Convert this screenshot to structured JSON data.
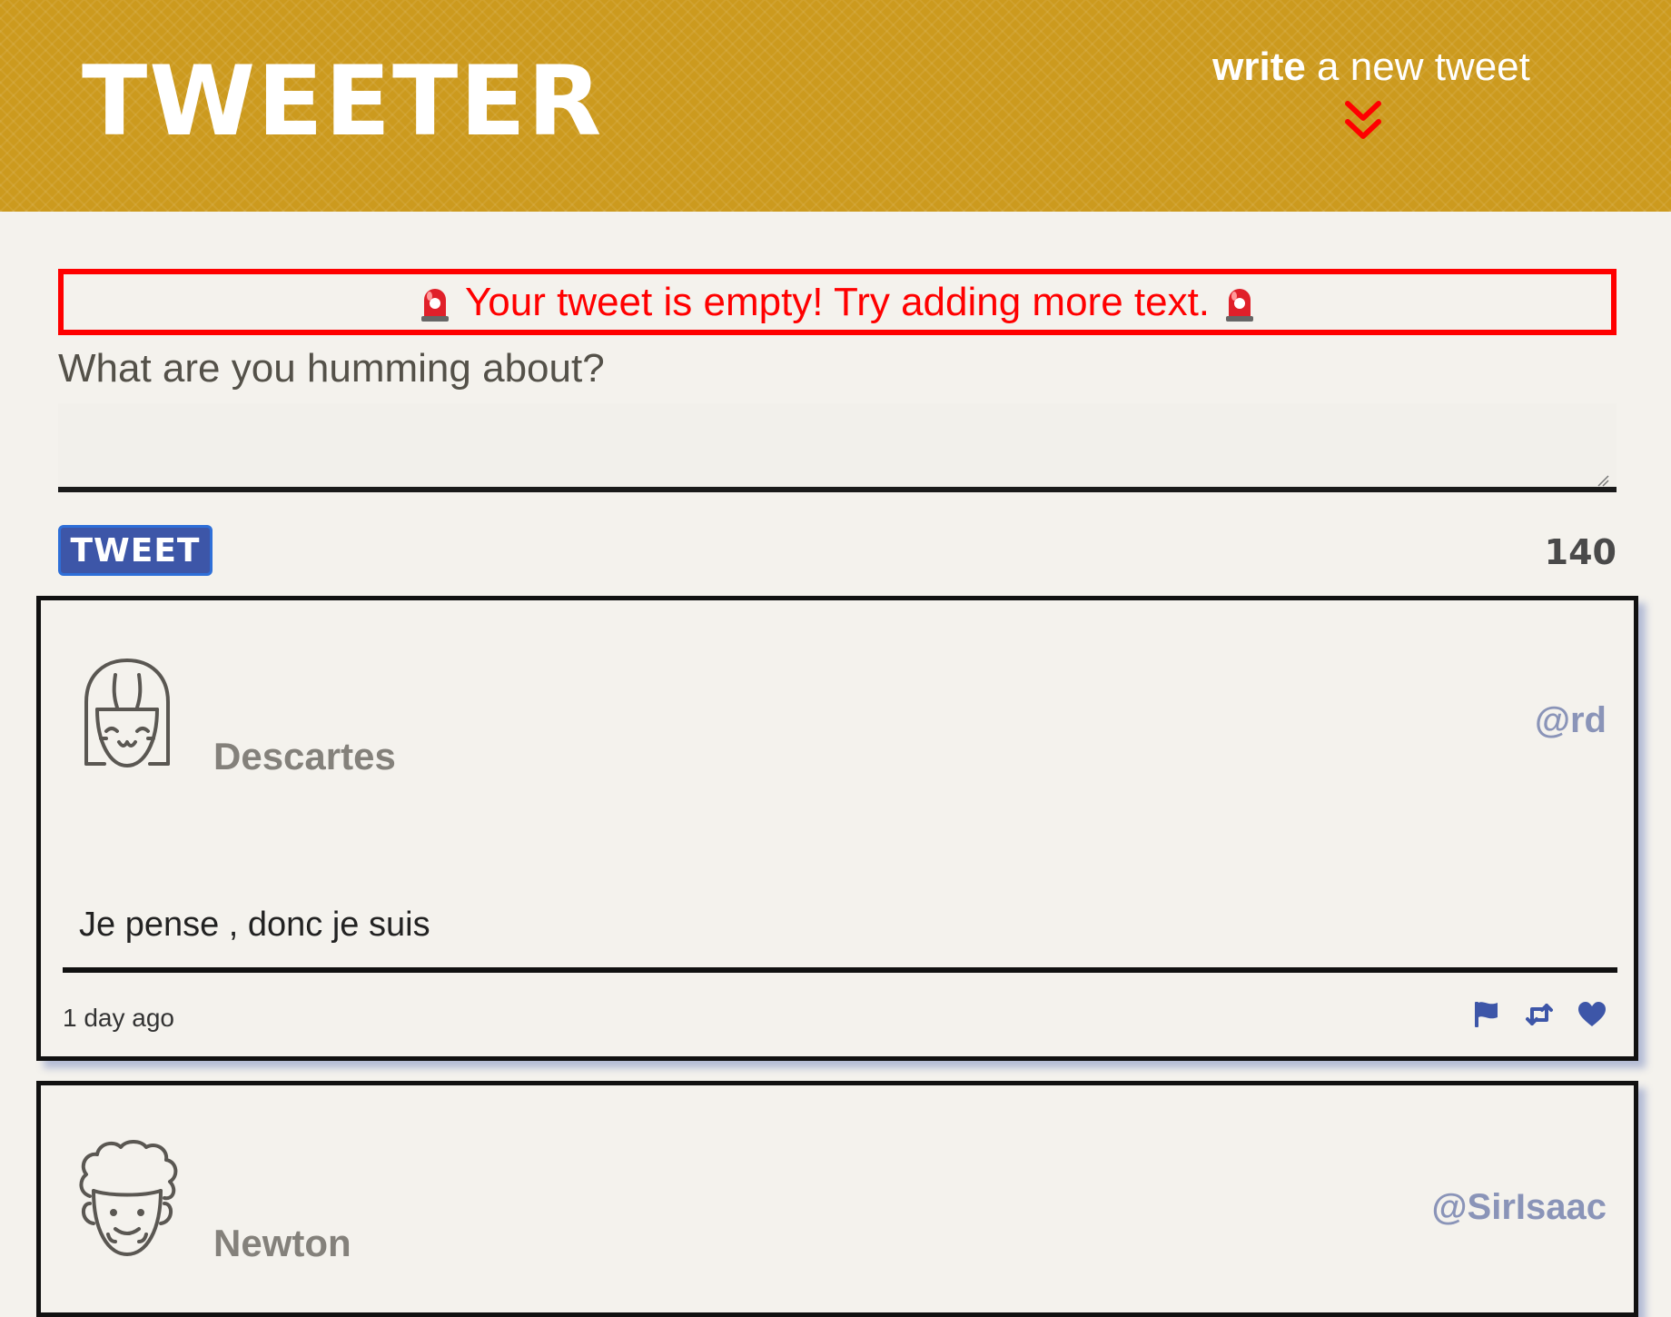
{
  "header": {
    "logo": "TWEETER",
    "compose_bold": "write",
    "compose_rest": " a new tweet"
  },
  "composer": {
    "error_message": "Your tweet is empty! Try adding more text.",
    "prompt": "What are you humming about?",
    "textarea_value": "",
    "button_label": "TWEET",
    "char_count": "140"
  },
  "tweets": [
    {
      "name": "Descartes",
      "handle": "@rd",
      "text": "Je pense , donc je suis",
      "time": "1 day ago"
    },
    {
      "name": "Newton",
      "handle": "@SirIsaac"
    }
  ],
  "icons": {
    "compose_chevron": "double-chevron-down-icon",
    "error_siren": "siren-icon",
    "flag": "flag-icon",
    "retweet": "retweet-icon",
    "like": "heart-icon"
  },
  "colors": {
    "header_bg": "#cc9a1e",
    "error": "#ff0000",
    "accent": "#3d56a8",
    "handle": "#8a94b8",
    "page_bg": "#f4f2ed"
  }
}
